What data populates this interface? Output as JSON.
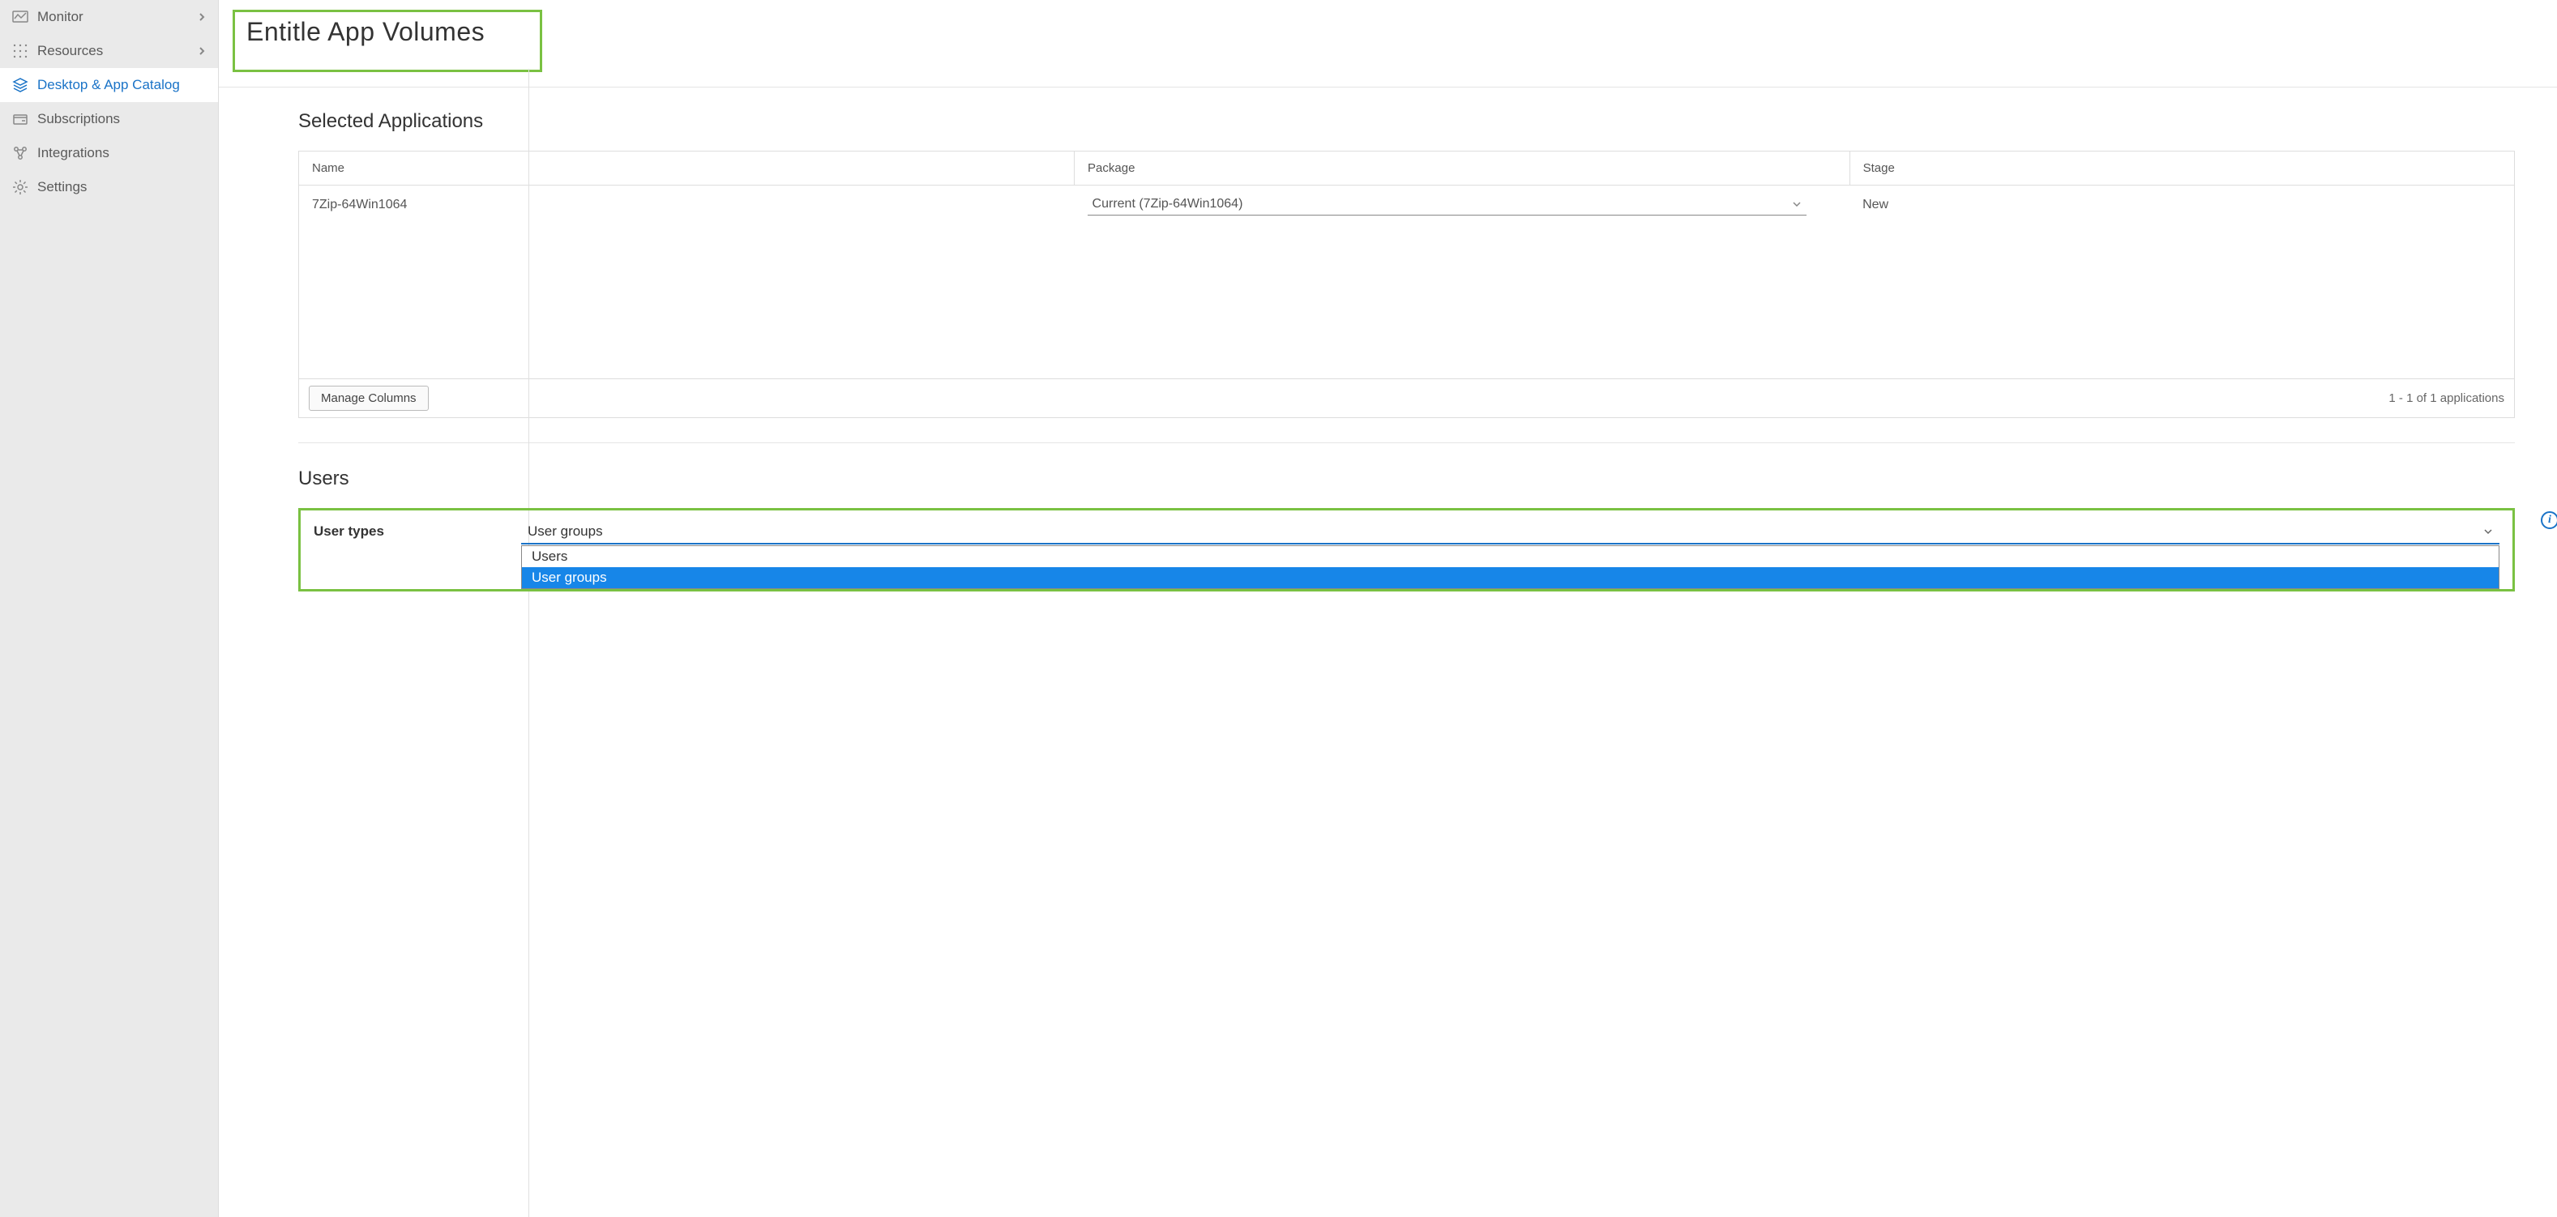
{
  "sidebar": {
    "items": [
      {
        "label": "Monitor",
        "icon": "monitor",
        "expandable": true,
        "active": false
      },
      {
        "label": "Resources",
        "icon": "resources",
        "expandable": true,
        "active": false
      },
      {
        "label": "Desktop & App Catalog",
        "icon": "catalog",
        "expandable": false,
        "active": true
      },
      {
        "label": "Subscriptions",
        "icon": "subscriptions",
        "expandable": false,
        "active": false
      },
      {
        "label": "Integrations",
        "icon": "integrations",
        "expandable": false,
        "active": false
      },
      {
        "label": "Settings",
        "icon": "settings",
        "expandable": false,
        "active": false
      }
    ]
  },
  "header": {
    "title": "Entitle App Volumes"
  },
  "sections": {
    "selected_apps": {
      "title": "Selected Applications",
      "columns": {
        "name": "Name",
        "package": "Package",
        "stage": "Stage"
      },
      "rows": [
        {
          "name": "7Zip-64Win1064",
          "package_selected": "Current (7Zip-64Win1064)",
          "stage": "New"
        }
      ],
      "manage_columns": "Manage Columns",
      "count_text": "1 - 1 of 1 applications"
    },
    "users": {
      "title": "Users",
      "field_label": "User types",
      "selected": "User groups",
      "options": [
        {
          "label": "Users",
          "highlight": false
        },
        {
          "label": "User groups",
          "highlight": true
        }
      ]
    }
  }
}
